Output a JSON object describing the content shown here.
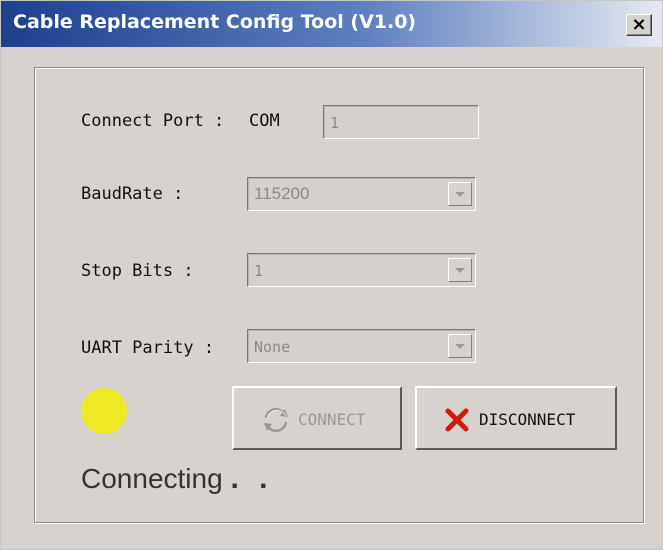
{
  "window": {
    "title": "Cable Replacement Config Tool (V1.0)",
    "close_label": "×"
  },
  "form": {
    "connect_port_label": "Connect Port :",
    "connect_port_prefix": "COM",
    "connect_port_value": "1",
    "baudrate_label": "BaudRate :",
    "baudrate_value": "115200",
    "stop_bits_label": "Stop Bits :",
    "stop_bits_value": "1",
    "uart_parity_label": "UART Parity :",
    "uart_parity_value": "None"
  },
  "buttons": {
    "connect_label": "CONNECT",
    "disconnect_label": "DISCONNECT"
  },
  "status": {
    "text": "Connecting",
    "dots": ". .",
    "indicator_color": "#f0e926"
  },
  "icons": {
    "connect": "refresh-arrows-icon",
    "disconnect": "red-x-icon",
    "close": "close-icon"
  }
}
